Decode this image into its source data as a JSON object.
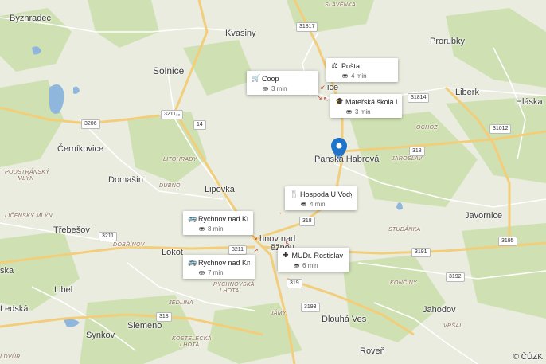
{
  "places": {
    "byzhradec": "Byzhradec",
    "kvasiny": "Kvasiny",
    "solnice": "Solnice",
    "prorubky": "Prorubky",
    "liberk": "Liberk",
    "hlaska": "Hláska",
    "cernikovice": "Černíkovice",
    "domasin": "Domašín",
    "lipovka": "Lipovka",
    "panska_habrova": "Panská Habrová",
    "javornice": "Javornice",
    "trebesov": "Třebešov",
    "lokot": "Lokot",
    "libel": "Libel",
    "ledska": "Ledská",
    "synkov": "Synkov",
    "slemeno": "Slemeno",
    "dlouha_ves": "Dlouhá Ves",
    "jahodov": "Jahodov",
    "roven": "Roveň",
    "rychnov_partial": "hnov nad",
    "rychnov_partial2": "ěžnou",
    "ska": "ska",
    "ice": "ice"
  },
  "small_labels": {
    "slavenka": "SLAVĚNKA",
    "podstransky": "PODSTRÁNSKÝ",
    "mlyn": "MLÝN",
    "litohrady": "LITOHRADY",
    "dubno": "DUBNO",
    "licensky": "LIČENSKÝ MLÝN",
    "dobrinov": "DOBŘÍNOV",
    "ochoz": "OCHOZ",
    "jaroslav": "JAROSLAV",
    "studanka": "STUDÁNKA",
    "koncinky": "KONČINY",
    "rychnovska": "RYCHNOVSKÁ",
    "lhota": "LHOTA",
    "jedlina": "JEDLINA",
    "jamy": "JÁMY",
    "vrsal": "VRŠAL",
    "kostelecka": "KOSTELECKÁ",
    "lhota2": "LHOTA",
    "dvur": "Í DVŮR"
  },
  "roads": {
    "r31817": "31817",
    "r3206": "3206",
    "r3211_18": "3211₁₈",
    "r14": "14",
    "r31814": "31814",
    "r31012": "31012",
    "r318a": "318",
    "r318b": "318",
    "r3211b": "3211",
    "r3211c": "3211",
    "r3195": "3195",
    "r3191": "3191",
    "r3192": "3192",
    "r319": "319",
    "r3193": "3193",
    "r318c": "318"
  },
  "pois": [
    {
      "name": "Pošta",
      "time": "4 min",
      "icon": "post-icon"
    },
    {
      "name": "Coop",
      "time": "3 min",
      "icon": "cart-icon"
    },
    {
      "name": "Mateřská škola L...",
      "time": "3 min",
      "icon": "school-icon"
    },
    {
      "name": "Hospoda U Vody",
      "time": "4 min",
      "icon": "restaurant-icon"
    },
    {
      "name": "Rychnov nad Kně...",
      "time": "8 min",
      "icon": "bus-icon"
    },
    {
      "name": "MUDr. Rostislav ...",
      "time": "6 min",
      "icon": "medical-icon"
    },
    {
      "name": "Rychnov nad Kně...",
      "time": "7 min",
      "icon": "bus-icon"
    }
  ],
  "copyright": "© ČÚZK",
  "colors": {
    "pin": "#1f73c8",
    "road": "#f5d27a",
    "water": "#8fb6dc",
    "forest": "#c8dcaa"
  }
}
